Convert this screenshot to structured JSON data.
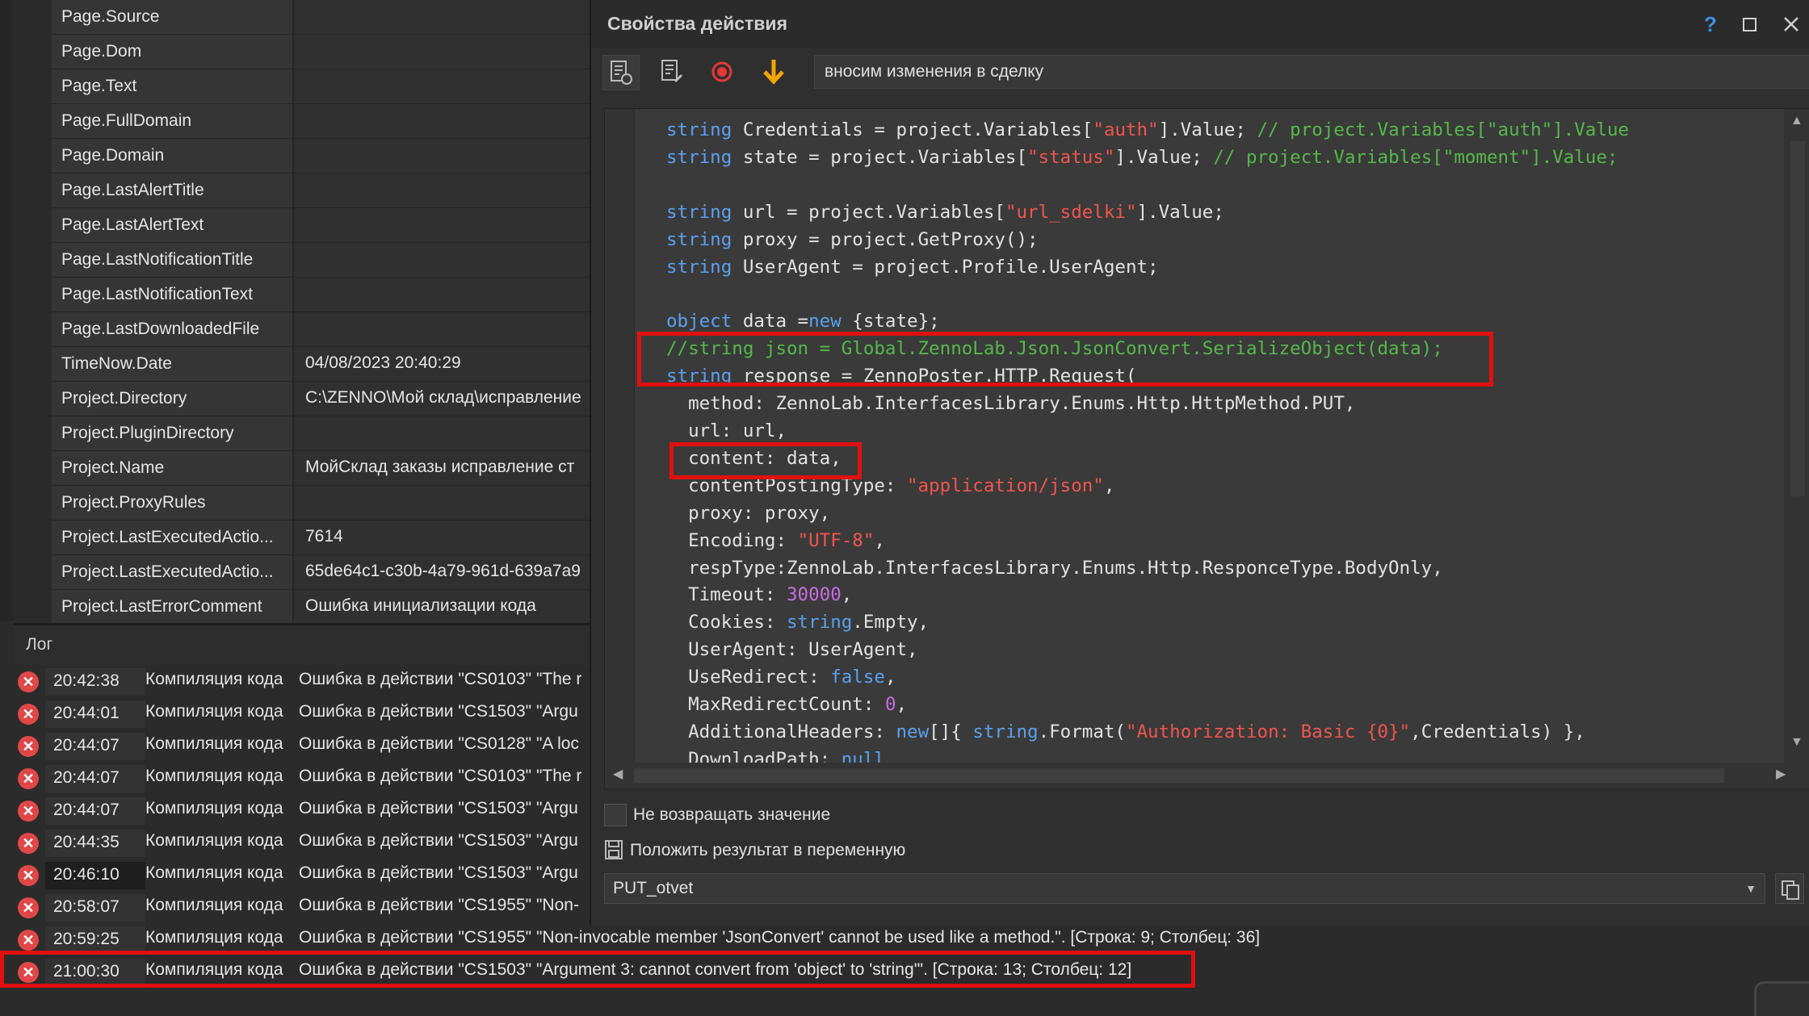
{
  "properties": [
    {
      "name": "Page.Source",
      "value": ""
    },
    {
      "name": "Page.Dom",
      "value": ""
    },
    {
      "name": "Page.Text",
      "value": ""
    },
    {
      "name": "Page.FullDomain",
      "value": ""
    },
    {
      "name": "Page.Domain",
      "value": ""
    },
    {
      "name": "Page.LastAlertTitle",
      "value": ""
    },
    {
      "name": "Page.LastAlertText",
      "value": ""
    },
    {
      "name": "Page.LastNotificationTitle",
      "value": ""
    },
    {
      "name": "Page.LastNotificationText",
      "value": ""
    },
    {
      "name": "Page.LastDownloadedFile",
      "value": ""
    },
    {
      "name": "TimeNow.Date",
      "value": "04/08/2023 20:40:29"
    },
    {
      "name": "Project.Directory",
      "value": "C:\\ZENNO\\Мой склад\\исправление"
    },
    {
      "name": "Project.PluginDirectory",
      "value": ""
    },
    {
      "name": "Project.Name",
      "value": "МойСклад заказы исправление ст"
    },
    {
      "name": "Project.ProxyRules",
      "value": ""
    },
    {
      "name": "Project.LastExecutedActio...",
      "value": "7614"
    },
    {
      "name": "Project.LastExecutedActio...",
      "value": "65de64c1-c30b-4a79-961d-639a7a9"
    },
    {
      "name": "Project.LastErrorComment",
      "value": "Ошибка инициализации кода"
    }
  ],
  "log": {
    "title": "Лог",
    "entries": [
      {
        "time": "20:42:38",
        "source": "Компиляция кода",
        "message": "Ошибка в действии \"CS0103\" \"The r"
      },
      {
        "time": "20:44:01",
        "source": "Компиляция кода",
        "message": "Ошибка в действии \"CS1503\" \"Argu"
      },
      {
        "time": "20:44:07",
        "source": "Компиляция кода",
        "message": "Ошибка в действии \"CS0128\" \"A loc"
      },
      {
        "time": "20:44:07",
        "source": "Компиляция кода",
        "message": "Ошибка в действии \"CS0103\" \"The r"
      },
      {
        "time": "20:44:07",
        "source": "Компиляция кода",
        "message": "Ошибка в действии \"CS1503\" \"Argu"
      },
      {
        "time": "20:44:35",
        "source": "Компиляция кода",
        "message": "Ошибка в действии \"CS1503\" \"Argu"
      },
      {
        "time": "20:46:10",
        "source": "Компиляция кода",
        "message": "Ошибка в действии \"CS1503\" \"Argu"
      },
      {
        "time": "20:58:07",
        "source": "Компиляция кода",
        "message": "Ошибка в действии \"CS1955\" \"Non-"
      },
      {
        "time": "20:59:25",
        "source": "Компиляция кода",
        "message": "Ошибка в действии \"CS1955\" \"Non-invocable member 'JsonConvert' cannot be used like a method.\". [Строка: 9; Столбец: 36]"
      },
      {
        "time": "21:00:30",
        "source": "Компиляция кода",
        "message": "Ошибка в действии \"CS1503\" \"Argument 3: cannot convert from 'object' to 'string'\". [Строка: 13; Столбец: 12]"
      }
    ]
  },
  "dialog": {
    "title": "Свойства действия",
    "help": "?",
    "maximize": "☐",
    "close": "✕",
    "action_name": "вносим изменения в сделку",
    "no_return_label": "Не возвращать значение",
    "put_result_label": "Положить результат в переменную",
    "variable": "PUT_otvet"
  },
  "code_lines": [
    [
      [
        "kw",
        "string"
      ],
      [
        "t",
        " Credentials = project.Variables["
      ],
      [
        "st",
        "\"auth\""
      ],
      [
        "t",
        "].Value; "
      ],
      [
        "cm",
        "// project.Variables[\"auth\"].Value"
      ]
    ],
    [
      [
        "kw",
        "string"
      ],
      [
        "t",
        " state = project.Variables["
      ],
      [
        "st",
        "\"status\""
      ],
      [
        "t",
        "].Value; "
      ],
      [
        "cm",
        "// project.Variables[\"moment\"].Value;"
      ]
    ],
    [],
    [
      [
        "kw",
        "string"
      ],
      [
        "t",
        " url = project.Variables["
      ],
      [
        "st",
        "\"url_sdelki\""
      ],
      [
        "t",
        "].Value;"
      ]
    ],
    [
      [
        "kw",
        "string"
      ],
      [
        "t",
        " proxy = project.GetProxy();"
      ]
    ],
    [
      [
        "kw",
        "string"
      ],
      [
        "t",
        " UserAgent = project.Profile.UserAgent;"
      ]
    ],
    [],
    [
      [
        "kw",
        "object"
      ],
      [
        "t",
        " data ="
      ],
      [
        "kw",
        "new"
      ],
      [
        "t",
        " {state};"
      ]
    ],
    [
      [
        "cm",
        "//string json = Global.ZennoLab.Json.JsonConvert.SerializeObject(data);"
      ]
    ],
    [
      [
        "kw",
        "string"
      ],
      [
        "t",
        " response = ZennoPoster.HTTP.Request("
      ]
    ],
    [
      [
        "t",
        "  method: ZennoLab.InterfacesLibrary.Enums.Http.HttpMethod.PUT,"
      ]
    ],
    [
      [
        "t",
        "  url: url,"
      ]
    ],
    [
      [
        "t",
        "  content: data,"
      ]
    ],
    [
      [
        "t",
        "  contentPostingType: "
      ],
      [
        "st",
        "\"application/json\""
      ],
      [
        "t",
        ","
      ]
    ],
    [
      [
        "t",
        "  proxy: proxy,"
      ]
    ],
    [
      [
        "t",
        "  Encoding: "
      ],
      [
        "st",
        "\"UTF-8\""
      ],
      [
        "t",
        ","
      ]
    ],
    [
      [
        "t",
        "  respType:ZennoLab.InterfacesLibrary.Enums.Http.ResponceType.BodyOnly,"
      ]
    ],
    [
      [
        "t",
        "  Timeout: "
      ],
      [
        "nm",
        "30000"
      ],
      [
        "t",
        ","
      ]
    ],
    [
      [
        "t",
        "  Cookies: "
      ],
      [
        "kw",
        "string"
      ],
      [
        "t",
        ".Empty,"
      ]
    ],
    [
      [
        "t",
        "  UserAgent: UserAgent,"
      ]
    ],
    [
      [
        "t",
        "  UseRedirect: "
      ],
      [
        "kw",
        "false"
      ],
      [
        "t",
        ","
      ]
    ],
    [
      [
        "t",
        "  MaxRedirectCount: "
      ],
      [
        "nm",
        "0"
      ],
      [
        "t",
        ","
      ]
    ],
    [
      [
        "t",
        "  AdditionalHeaders: "
      ],
      [
        "kw",
        "new"
      ],
      [
        "t",
        "[]{ "
      ],
      [
        "kw",
        "string"
      ],
      [
        "t",
        ".Format("
      ],
      [
        "st",
        "\"Authorization: Basic {0}\""
      ],
      [
        "t",
        ",Credentials) },"
      ]
    ],
    [
      [
        "t",
        "  DownloadPath: "
      ],
      [
        "kw",
        "null"
      ]
    ]
  ],
  "colors": {
    "keyword": "#5aa0ef",
    "string": "#f0554e",
    "comment": "#55b84a",
    "number": "#c86de0",
    "highlight_box": "#e01010",
    "error_icon": "#e04848"
  }
}
